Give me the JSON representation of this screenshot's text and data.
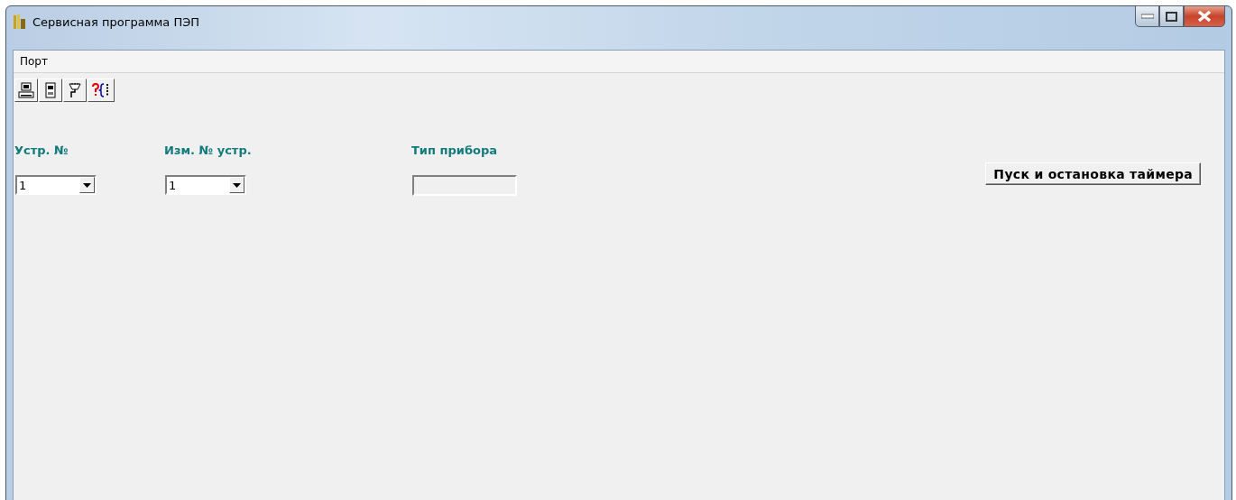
{
  "window": {
    "title": "Сервисная программа ПЭП"
  },
  "menu": [
    {
      "label": "Порт"
    }
  ],
  "toolbar": [
    {
      "kind": "computer"
    },
    {
      "kind": "device"
    },
    {
      "kind": "plug"
    },
    {
      "kind": "help"
    }
  ],
  "fields": [
    {
      "kind": "combo",
      "label": "Устр. №",
      "value": "1"
    },
    {
      "kind": "combo",
      "label": "Изм. № устр.",
      "value": "1"
    },
    {
      "kind": "text",
      "label": "Тип прибора"
    }
  ],
  "timer_button": {
    "label": "Пуск и остановка таймера"
  }
}
